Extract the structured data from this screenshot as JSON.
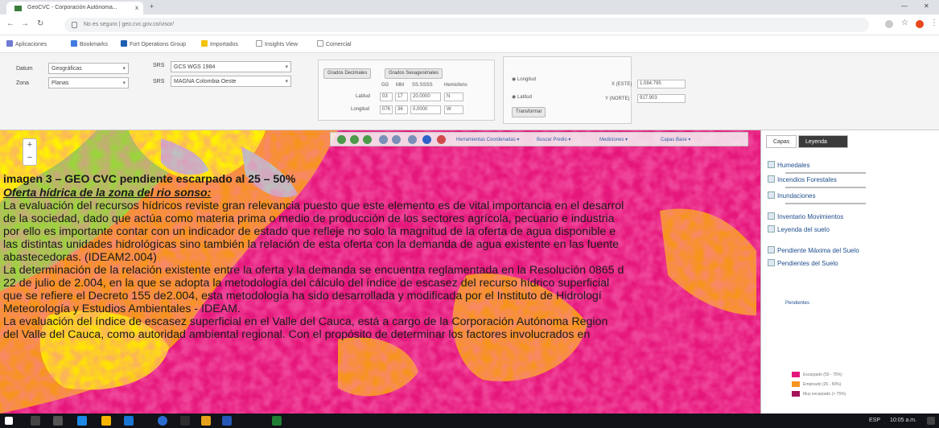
{
  "browser": {
    "tab_title": "GeoCVC - Corporación Autónoma...",
    "tab_close": "x",
    "new_tab": "+",
    "url": "No es seguro  |  geo.cvc.gov.co/visor/",
    "bookmarks": [
      "Aplicaciones",
      "Bookmarks",
      "Fort Operations Group",
      "Importados",
      "Insights View",
      "Comercial"
    ]
  },
  "geo_panel": {
    "datum_label": "Datum",
    "datum_value": "Geográficas",
    "zone_label": "Zona",
    "zone_value": "Planas",
    "crs_label1": "SRS",
    "crs_value1": "GCS WGS 1984",
    "crs_label2": "SRS",
    "crs_value2": "MAGNA Colombia Oeste",
    "btn_decimal": "Grados Decimales",
    "btn_sexagesimal": "Grados Sexagesimales",
    "grid_headers": [
      "GG",
      "MM",
      "SS.SSSS",
      "Hemisferio"
    ],
    "row1_label": "Latitud",
    "row1_values": [
      "03",
      "17",
      "20,0000",
      "N"
    ],
    "row2_label": "Longitud",
    "row2_values": [
      "076",
      "36",
      "0,0000",
      "W"
    ],
    "option_longitud": "Longitud",
    "option_latitud": "Latitud",
    "transform_button": "Transformar",
    "coord_x_label": "X (ESTE)",
    "coord_x_value": "1.084.795",
    "coord_y_label": "Y (NORTE)",
    "coord_y_value": "917.903"
  },
  "map_toolbar": {
    "menu1": "Herramientas Coordenadas",
    "menu2": "Buscar Predio",
    "menu3": "Mediciones",
    "menu4": "Capas Base"
  },
  "zoom": {
    "in": "+",
    "out": "−"
  },
  "layers_panel": {
    "tab_active": "Capas",
    "tab_other": "Leyenda",
    "items": [
      "Humedales",
      "Incendios Forestales",
      "Inundaciones",
      "Inventario Movimientos",
      "Leyenda del suelo",
      "Pendiente Máxima del Suelo",
      "Pendientes del Suelo",
      "Pendientes"
    ],
    "legend": [
      "Escarpado (50 - 75%)",
      "Empinado (25 - 50%)",
      "Muy escarpado (> 75%)"
    ]
  },
  "document": {
    "caption": "imagen 3 – GEO CVC pendiente escarpado al 25 – 50%",
    "subheading": "Oferta hídrica de la zona del rio sonso:",
    "para1": [
      "La evaluación del recursos hídricos reviste gran relevancia puesto que este elemento es de vital importancia en el desarrol",
      "de la sociedad, dado que actúa como materia prima o medio de producción de los sectores agrícola, pecuario e industria",
      "por ello es importante contar con un indicador de estado que refleje no solo la magnitud de la oferta de agua disponible e",
      "las distintas unidades hidrológicas sino también la relación de esta oferta con la demanda de agua existente en las fuente",
      "abastecedoras. (IDEAM2.004)"
    ],
    "para2": [
      "La determinación de la relación existente entre la oferta y la demanda se encuentra reglamentada en la Resolución 0865 d",
      "22 de julio de 2.004, en la que se adopta la metodología del cálculo del índice de escasez del recurso hídrico superficial",
      "que se refiere el Decreto 155 de2.004, esta metodología ha sido desarrollada y modificada por el Instituto de Hidrologí",
      "Meteorología y Estudios Ambientales - IDEAM."
    ],
    "para3": [
      "La evaluación del índice de escasez superficial en el Valle del Cauca, está a cargo de la Corporación Autónoma Region",
      "del Valle del Cauca, como autoridad ambiental regional. Con el propósito de determinar los factores involucrados en"
    ]
  },
  "taskbar": {
    "tray_text": "ESP",
    "clock": "10:05 a.m."
  },
  "colors": {
    "map_magenta": "#e6177c",
    "map_orange": "#f7941d",
    "map_yellow": "#fff200",
    "map_green": "#9bd43d",
    "map_gray": "#bfbfbf"
  }
}
